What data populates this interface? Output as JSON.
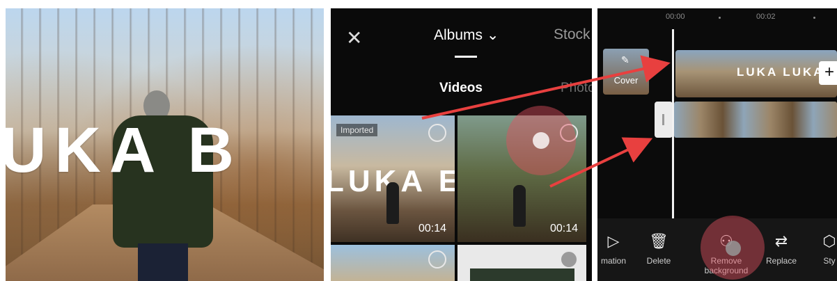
{
  "photo": {
    "overlay_text": "UKA B"
  },
  "picker": {
    "close_icon": "close-icon",
    "albums_label": "Albums ⌄",
    "stock_label": "Stock",
    "tab_videos": "Videos",
    "tab_photos": "Photo",
    "thumbs": [
      {
        "badge": "Imported",
        "overlay_text": "LUKA E",
        "duration": "00:14"
      },
      {
        "duration": "00:14"
      }
    ]
  },
  "editor": {
    "ruler": {
      "t0": "00:00",
      "t2": "00:02"
    },
    "cover_label": "Cover",
    "clip_text": "LUKA LUKA E",
    "add_label": "+",
    "tools": [
      {
        "icon": "▷",
        "label": "mation"
      },
      {
        "icon": "🗑",
        "label": "Delete"
      },
      {
        "icon": "⚇",
        "label": "Remove background"
      },
      {
        "icon": "⇄",
        "label": "Replace"
      },
      {
        "icon": "⬡",
        "label": "Sty"
      }
    ]
  },
  "colors": {
    "arrow": "#e8403f",
    "touch": "#e2505f",
    "dark_bg": "#0a0a0a"
  }
}
